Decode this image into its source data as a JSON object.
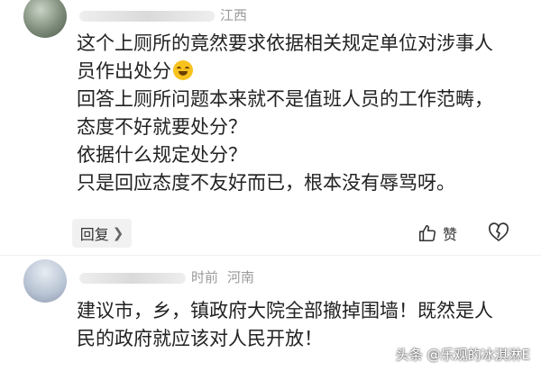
{
  "comments": [
    {
      "location": "江西",
      "lines": [
        "这个上厕所的竟然要求依据相关规定单位对涉事人",
        "员作出处分",
        "回答上厕所问题本来就不是值班人员的工作范畴，",
        "态度不好就要处分？",
        "依据什么规定处分？",
        "只是回应态度不友好而已，根本没有辱骂呀。"
      ],
      "emoji": "laughing-emoji",
      "reply_label": "回复",
      "like_label": "赞"
    },
    {
      "time": "时前",
      "location": "河南",
      "lines": [
        "建议市，乡，镇政府大院全部撤掉围墙！既然是人",
        "民的政府就应该对人民开放！"
      ]
    }
  ],
  "watermark": "头条 @乐观的冰淇淋E",
  "icons": {
    "like": "thumbs-up-icon",
    "dislike": "broken-heart-icon",
    "reply": "chevron-right-icon"
  }
}
